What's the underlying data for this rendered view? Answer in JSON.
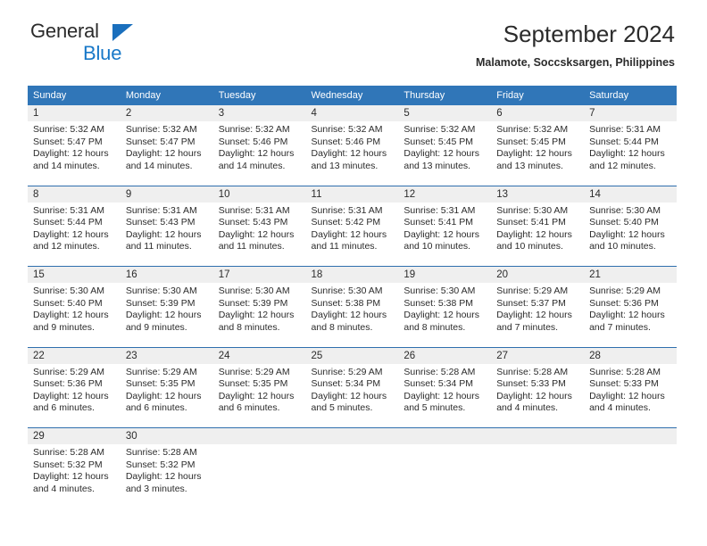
{
  "brand": {
    "name_top": "General",
    "name_bottom": "Blue",
    "triangle_color": "#1a6fbd",
    "blue_text_color": "#1878c8"
  },
  "header": {
    "title": "September 2024",
    "subtitle": "Malamote, Soccsksargen, Philippines"
  },
  "colors": {
    "header_bar": "#3076b8",
    "daynum_band": "#efefef",
    "row_rule": "#2f6fae",
    "text": "#2b2b2b"
  },
  "calendar": {
    "weekday_headers": [
      "Sunday",
      "Monday",
      "Tuesday",
      "Wednesday",
      "Thursday",
      "Friday",
      "Saturday"
    ],
    "weeks": [
      [
        {
          "day": "1",
          "sunrise": "Sunrise: 5:32 AM",
          "sunset": "Sunset: 5:47 PM",
          "daylight1": "Daylight: 12 hours",
          "daylight2": "and 14 minutes."
        },
        {
          "day": "2",
          "sunrise": "Sunrise: 5:32 AM",
          "sunset": "Sunset: 5:47 PM",
          "daylight1": "Daylight: 12 hours",
          "daylight2": "and 14 minutes."
        },
        {
          "day": "3",
          "sunrise": "Sunrise: 5:32 AM",
          "sunset": "Sunset: 5:46 PM",
          "daylight1": "Daylight: 12 hours",
          "daylight2": "and 14 minutes."
        },
        {
          "day": "4",
          "sunrise": "Sunrise: 5:32 AM",
          "sunset": "Sunset: 5:46 PM",
          "daylight1": "Daylight: 12 hours",
          "daylight2": "and 13 minutes."
        },
        {
          "day": "5",
          "sunrise": "Sunrise: 5:32 AM",
          "sunset": "Sunset: 5:45 PM",
          "daylight1": "Daylight: 12 hours",
          "daylight2": "and 13 minutes."
        },
        {
          "day": "6",
          "sunrise": "Sunrise: 5:32 AM",
          "sunset": "Sunset: 5:45 PM",
          "daylight1": "Daylight: 12 hours",
          "daylight2": "and 13 minutes."
        },
        {
          "day": "7",
          "sunrise": "Sunrise: 5:31 AM",
          "sunset": "Sunset: 5:44 PM",
          "daylight1": "Daylight: 12 hours",
          "daylight2": "and 12 minutes."
        }
      ],
      [
        {
          "day": "8",
          "sunrise": "Sunrise: 5:31 AM",
          "sunset": "Sunset: 5:44 PM",
          "daylight1": "Daylight: 12 hours",
          "daylight2": "and 12 minutes."
        },
        {
          "day": "9",
          "sunrise": "Sunrise: 5:31 AM",
          "sunset": "Sunset: 5:43 PM",
          "daylight1": "Daylight: 12 hours",
          "daylight2": "and 11 minutes."
        },
        {
          "day": "10",
          "sunrise": "Sunrise: 5:31 AM",
          "sunset": "Sunset: 5:43 PM",
          "daylight1": "Daylight: 12 hours",
          "daylight2": "and 11 minutes."
        },
        {
          "day": "11",
          "sunrise": "Sunrise: 5:31 AM",
          "sunset": "Sunset: 5:42 PM",
          "daylight1": "Daylight: 12 hours",
          "daylight2": "and 11 minutes."
        },
        {
          "day": "12",
          "sunrise": "Sunrise: 5:31 AM",
          "sunset": "Sunset: 5:41 PM",
          "daylight1": "Daylight: 12 hours",
          "daylight2": "and 10 minutes."
        },
        {
          "day": "13",
          "sunrise": "Sunrise: 5:30 AM",
          "sunset": "Sunset: 5:41 PM",
          "daylight1": "Daylight: 12 hours",
          "daylight2": "and 10 minutes."
        },
        {
          "day": "14",
          "sunrise": "Sunrise: 5:30 AM",
          "sunset": "Sunset: 5:40 PM",
          "daylight1": "Daylight: 12 hours",
          "daylight2": "and 10 minutes."
        }
      ],
      [
        {
          "day": "15",
          "sunrise": "Sunrise: 5:30 AM",
          "sunset": "Sunset: 5:40 PM",
          "daylight1": "Daylight: 12 hours",
          "daylight2": "and 9 minutes."
        },
        {
          "day": "16",
          "sunrise": "Sunrise: 5:30 AM",
          "sunset": "Sunset: 5:39 PM",
          "daylight1": "Daylight: 12 hours",
          "daylight2": "and 9 minutes."
        },
        {
          "day": "17",
          "sunrise": "Sunrise: 5:30 AM",
          "sunset": "Sunset: 5:39 PM",
          "daylight1": "Daylight: 12 hours",
          "daylight2": "and 8 minutes."
        },
        {
          "day": "18",
          "sunrise": "Sunrise: 5:30 AM",
          "sunset": "Sunset: 5:38 PM",
          "daylight1": "Daylight: 12 hours",
          "daylight2": "and 8 minutes."
        },
        {
          "day": "19",
          "sunrise": "Sunrise: 5:30 AM",
          "sunset": "Sunset: 5:38 PM",
          "daylight1": "Daylight: 12 hours",
          "daylight2": "and 8 minutes."
        },
        {
          "day": "20",
          "sunrise": "Sunrise: 5:29 AM",
          "sunset": "Sunset: 5:37 PM",
          "daylight1": "Daylight: 12 hours",
          "daylight2": "and 7 minutes."
        },
        {
          "day": "21",
          "sunrise": "Sunrise: 5:29 AM",
          "sunset": "Sunset: 5:36 PM",
          "daylight1": "Daylight: 12 hours",
          "daylight2": "and 7 minutes."
        }
      ],
      [
        {
          "day": "22",
          "sunrise": "Sunrise: 5:29 AM",
          "sunset": "Sunset: 5:36 PM",
          "daylight1": "Daylight: 12 hours",
          "daylight2": "and 6 minutes."
        },
        {
          "day": "23",
          "sunrise": "Sunrise: 5:29 AM",
          "sunset": "Sunset: 5:35 PM",
          "daylight1": "Daylight: 12 hours",
          "daylight2": "and 6 minutes."
        },
        {
          "day": "24",
          "sunrise": "Sunrise: 5:29 AM",
          "sunset": "Sunset: 5:35 PM",
          "daylight1": "Daylight: 12 hours",
          "daylight2": "and 6 minutes."
        },
        {
          "day": "25",
          "sunrise": "Sunrise: 5:29 AM",
          "sunset": "Sunset: 5:34 PM",
          "daylight1": "Daylight: 12 hours",
          "daylight2": "and 5 minutes."
        },
        {
          "day": "26",
          "sunrise": "Sunrise: 5:28 AM",
          "sunset": "Sunset: 5:34 PM",
          "daylight1": "Daylight: 12 hours",
          "daylight2": "and 5 minutes."
        },
        {
          "day": "27",
          "sunrise": "Sunrise: 5:28 AM",
          "sunset": "Sunset: 5:33 PM",
          "daylight1": "Daylight: 12 hours",
          "daylight2": "and 4 minutes."
        },
        {
          "day": "28",
          "sunrise": "Sunrise: 5:28 AM",
          "sunset": "Sunset: 5:33 PM",
          "daylight1": "Daylight: 12 hours",
          "daylight2": "and 4 minutes."
        }
      ],
      [
        {
          "day": "29",
          "sunrise": "Sunrise: 5:28 AM",
          "sunset": "Sunset: 5:32 PM",
          "daylight1": "Daylight: 12 hours",
          "daylight2": "and 4 minutes."
        },
        {
          "day": "30",
          "sunrise": "Sunrise: 5:28 AM",
          "sunset": "Sunset: 5:32 PM",
          "daylight1": "Daylight: 12 hours",
          "daylight2": "and 3 minutes."
        },
        {
          "day": "",
          "sunrise": "",
          "sunset": "",
          "daylight1": "",
          "daylight2": ""
        },
        {
          "day": "",
          "sunrise": "",
          "sunset": "",
          "daylight1": "",
          "daylight2": ""
        },
        {
          "day": "",
          "sunrise": "",
          "sunset": "",
          "daylight1": "",
          "daylight2": ""
        },
        {
          "day": "",
          "sunrise": "",
          "sunset": "",
          "daylight1": "",
          "daylight2": ""
        },
        {
          "day": "",
          "sunrise": "",
          "sunset": "",
          "daylight1": "",
          "daylight2": ""
        }
      ]
    ]
  }
}
